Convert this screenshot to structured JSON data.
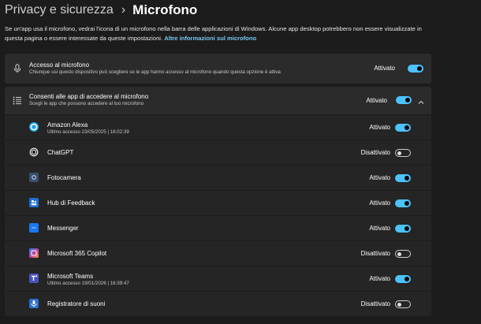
{
  "header": {
    "breadcrumb_parent": "Privacy e sicurezza",
    "separator": "›",
    "title": "Microfono"
  },
  "description": {
    "text": "Se un'app usa il microfono, vedrai l'icona di un microfono nella barra delle applicazioni di Windows. Alcune app desktop potrebbero non essere visualizzate in questa pagina o essere interessate da queste impostazioni.",
    "link": "Altre informazioni sul microfono"
  },
  "mic_access": {
    "icon": "microphone-icon",
    "title": "Accesso al microfono",
    "subtitle": "Chiunque usi questo dispositivo può scegliere se le app hanno accesso al microfono quando questa opzione è attiva",
    "state": "Attivato",
    "on": true
  },
  "app_access": {
    "icon": "list-icon",
    "title": "Consenti alle app di accedere al microfono",
    "subtitle": "Scegli le app che possono accedere al tuo microfono",
    "state": "Attivato",
    "on": true,
    "expand_icon": "chevron-up-icon"
  },
  "apps": [
    {
      "name": "Amazon Alexa",
      "meta": "Ultimo accesso 23/05/2025  |  16:02:39",
      "state": "Attivato",
      "on": true,
      "icon": "alexa-icon",
      "color": "#1aa3e8"
    },
    {
      "name": "ChatGPT",
      "meta": "",
      "state": "Disattivato",
      "on": false,
      "icon": "chatgpt-icon",
      "color": "#ffffff"
    },
    {
      "name": "Fotocamera",
      "meta": "",
      "state": "Attivato",
      "on": true,
      "icon": "camera-icon",
      "color": "#3a4f6e"
    },
    {
      "name": "Hub di Feedback",
      "meta": "",
      "state": "Attivato",
      "on": true,
      "icon": "feedback-hub-icon",
      "color": "#1f6fd1"
    },
    {
      "name": "Messenger",
      "meta": "",
      "state": "Attivato",
      "on": true,
      "icon": "messenger-icon",
      "color": "#1877f2"
    },
    {
      "name": "Microsoft 365 Copilot",
      "meta": "",
      "state": "Disattivato",
      "on": false,
      "icon": "copilot-icon",
      "color": "#c43e9e"
    },
    {
      "name": "Microsoft Teams",
      "meta": "Ultimo accesso 19/01/2026  |  16:39:47",
      "state": "Attivato",
      "on": true,
      "icon": "teams-icon",
      "color": "#4b53bc"
    },
    {
      "name": "Registratore di suoni",
      "meta": "",
      "state": "Disattivato",
      "on": false,
      "icon": "sound-recorder-icon",
      "color": "#2a72d4"
    }
  ],
  "colors": {
    "background": "#1c1c1c",
    "card": "#2b2b2b",
    "row": "#252525",
    "accent": "#4cc2ff",
    "link": "#7ac8f5"
  }
}
